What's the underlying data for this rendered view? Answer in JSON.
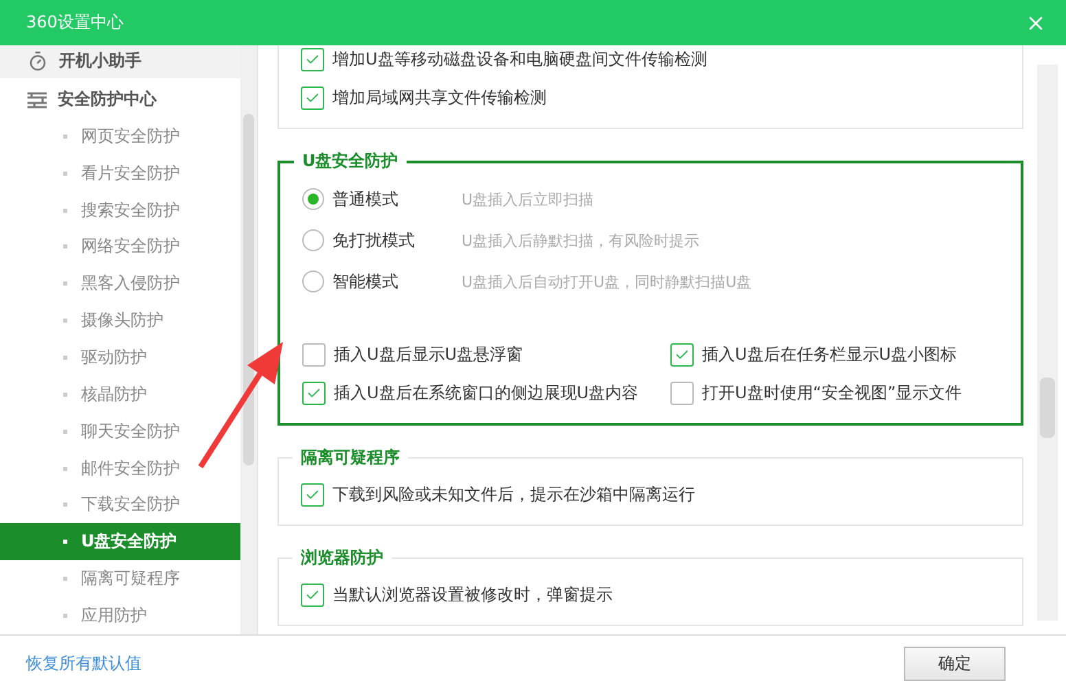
{
  "window": {
    "title": "360设置中心"
  },
  "sidebar": {
    "items": [
      {
        "label": "开机小助手",
        "hovered": true
      },
      {
        "label": "安全防护中心",
        "hovered": false,
        "children": [
          {
            "label": "网页安全防护",
            "selected": false
          },
          {
            "label": "看片安全防护",
            "selected": false
          },
          {
            "label": "搜索安全防护",
            "selected": false
          },
          {
            "label": "网络安全防护",
            "selected": false
          },
          {
            "label": "黑客入侵防护",
            "selected": false
          },
          {
            "label": "摄像头防护",
            "selected": false
          },
          {
            "label": "驱动防护",
            "selected": false
          },
          {
            "label": "核晶防护",
            "selected": false
          },
          {
            "label": "聊天安全防护",
            "selected": false
          },
          {
            "label": "邮件安全防护",
            "selected": false
          },
          {
            "label": "下载安全防护",
            "selected": false
          },
          {
            "label": "U盘安全防护",
            "selected": true
          },
          {
            "label": "隔离可疑程序",
            "selected": false
          },
          {
            "label": "应用防护",
            "selected": false
          }
        ]
      }
    ]
  },
  "sections": [
    {
      "highlighted": false,
      "options": [
        {
          "label": "增加U盘等移动磁盘设备和电脑硬盘间文件传输检测",
          "checked": true
        },
        {
          "label": "增加局域网共享文件传输检测",
          "checked": true
        }
      ]
    },
    {
      "title": "U盘安全防护",
      "highlighted": true,
      "modes": [
        {
          "label": "普通模式",
          "description": "U盘插入后立即扫描",
          "selected": true
        },
        {
          "label": "免打扰模式",
          "description": "U盘插入后静默扫描，有风险时提示",
          "selected": false
        },
        {
          "label": "智能模式",
          "description": "U盘插入后自动打开U盘，同时静默扫描U盘",
          "selected": false
        }
      ],
      "options": [
        {
          "label": "插入U盘后显示U盘悬浮窗",
          "checked": false
        },
        {
          "label": "插入U盘后在任务栏显示U盘小图标",
          "checked": true
        },
        {
          "label": "插入U盘后在系统窗口的侧边展现U盘内容",
          "checked": true
        },
        {
          "label": "打开U盘时使用“安全视图”显示文件",
          "checked": false
        }
      ]
    },
    {
      "title": "隔离可疑程序",
      "highlighted": false,
      "options": [
        {
          "label": "下载到风险或未知文件后，提示在沙箱中隔离运行",
          "checked": true
        }
      ]
    },
    {
      "title": "浏览器防护",
      "highlighted": false,
      "options": [
        {
          "label": "当默认浏览器设置被修改时，弹窗提示",
          "checked": true
        }
      ]
    }
  ],
  "footer": {
    "reset_link": "恢复所有默认值",
    "ok_button": "确定"
  },
  "annotation_arrow": true
}
